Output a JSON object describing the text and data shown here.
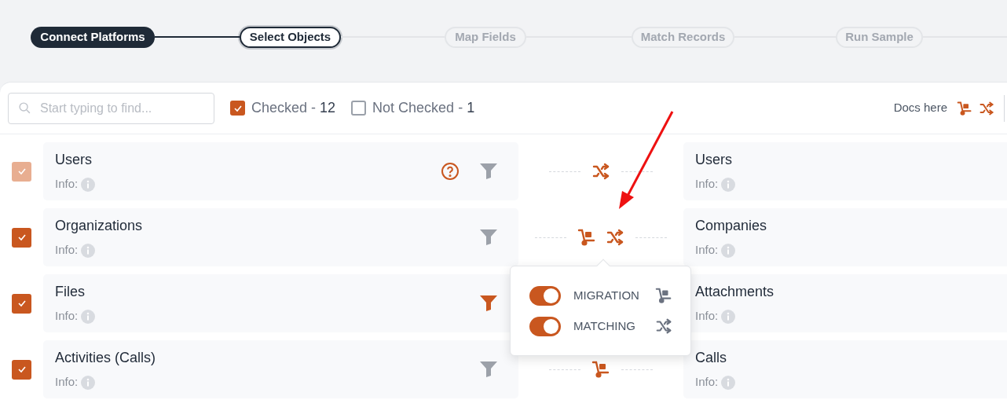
{
  "steps": [
    {
      "label": "Connect Platforms",
      "completed": true,
      "selected": false
    },
    {
      "label": "Select Objects",
      "completed": false,
      "selected": true
    },
    {
      "label": "Map Fields",
      "completed": false,
      "selected": false
    },
    {
      "label": "Match Records",
      "completed": false,
      "selected": false
    },
    {
      "label": "Run Sample",
      "completed": false,
      "selected": false
    }
  ],
  "search": {
    "placeholder": "Start typing to find..."
  },
  "filters": [
    {
      "label": "Checked -",
      "count": "12",
      "checked": true
    },
    {
      "label": "Not Checked -",
      "count": "1",
      "checked": false
    }
  ],
  "docs": {
    "label": "Docs here",
    "icons": [
      {
        "kind": "migration"
      },
      {
        "kind": "matching"
      }
    ]
  },
  "rows": [
    {
      "checked": true,
      "disabled": true,
      "source": {
        "name": "Users",
        "info": "Info:"
      },
      "help": true,
      "filter_active": false,
      "links": [
        {
          "kind": "matching"
        }
      ],
      "target": {
        "name": "Users",
        "info": "Info:"
      }
    },
    {
      "checked": true,
      "disabled": false,
      "source": {
        "name": "Organizations",
        "info": "Info:"
      },
      "help": false,
      "filter_active": false,
      "links": [
        {
          "kind": "migration"
        },
        {
          "kind": "matching"
        }
      ],
      "target": {
        "name": "Companies",
        "info": "Info:"
      }
    },
    {
      "checked": true,
      "disabled": false,
      "source": {
        "name": "Files",
        "info": "Info:"
      },
      "help": false,
      "filter_active": true,
      "target": {
        "name": "Attachments",
        "info": "Info:"
      }
    },
    {
      "checked": true,
      "disabled": false,
      "source": {
        "name": "Activities (Calls)",
        "info": "Info:"
      },
      "help": false,
      "filter_active": false,
      "links": [
        {
          "kind": "migration"
        }
      ],
      "target": {
        "name": "Calls",
        "info": "Info:"
      }
    }
  ],
  "popover": {
    "toggles": [
      {
        "label": "MIGRATION",
        "on": true,
        "kind": "migration"
      },
      {
        "label": "MATCHING",
        "on": true,
        "kind": "matching"
      }
    ]
  }
}
